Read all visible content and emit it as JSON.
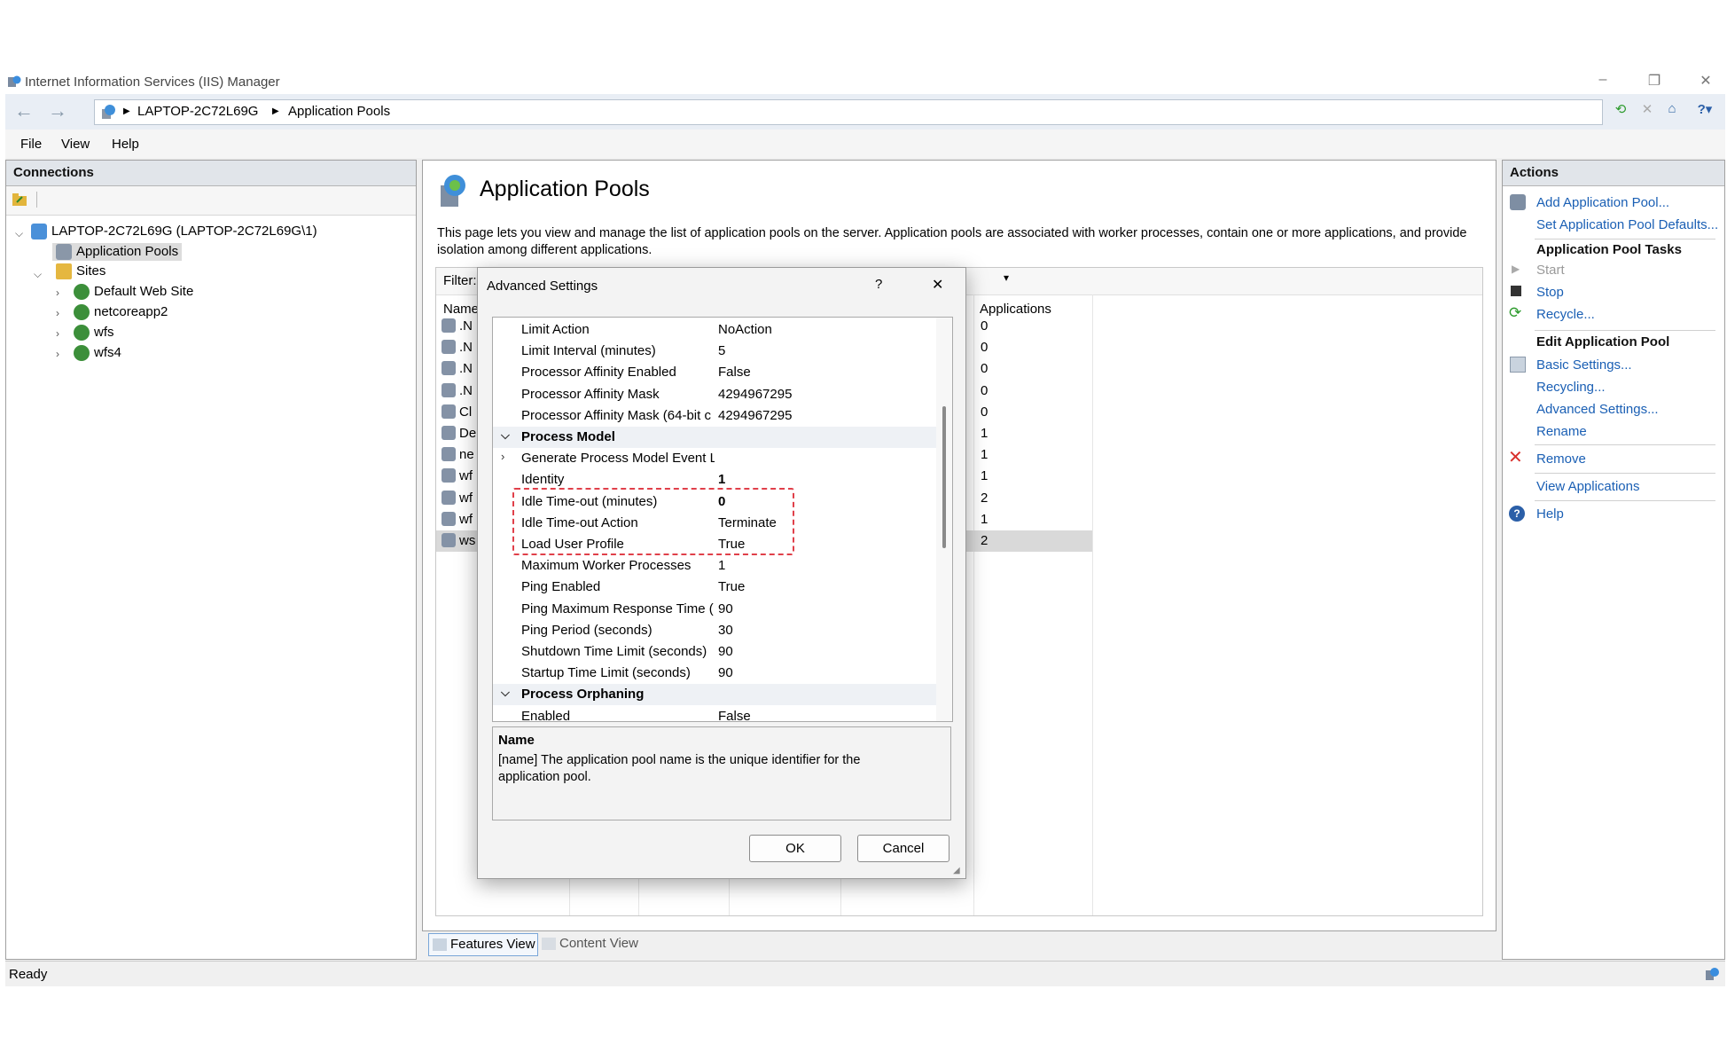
{
  "window": {
    "title": "Internet Information Services (IIS) Manager",
    "controls": [
      "–",
      "❐",
      "✕"
    ]
  },
  "address": {
    "breadcrumb": [
      "LAPTOP-2C72L69G",
      "Application Pools"
    ]
  },
  "menu": [
    "File",
    "View",
    "Help"
  ],
  "connections": {
    "title": "Connections",
    "server": "LAPTOP-2C72L69G (LAPTOP-2C72L69G\\1)",
    "app_pools": "Application Pools",
    "sites": "Sites",
    "site_list": [
      "Default Web Site",
      "netcoreapp2",
      "wfs",
      "wfs4"
    ]
  },
  "main": {
    "title": "Application Pools",
    "description": "This page lets you view and manage the list of application pools on the server. Application pools are associated with worker processes, contain one or more applications, and provide isolation among different applications.",
    "filter_label": "Filter:",
    "col_name": "Name",
    "col_applications": "Applications",
    "rows": [
      {
        "name": ".N",
        "apps": "0"
      },
      {
        "name": ".N",
        "apps": "0"
      },
      {
        "name": ".N",
        "apps": "0"
      },
      {
        "name": ".N",
        "apps": "0"
      },
      {
        "name": "Cl",
        "apps": "0"
      },
      {
        "name": "De",
        "apps": "1"
      },
      {
        "name": "ne",
        "apps": "1"
      },
      {
        "name": "wf",
        "apps": "1"
      },
      {
        "name": "wf",
        "apps": "2"
      },
      {
        "name": "wf",
        "apps": "1"
      },
      {
        "name": "ws",
        "apps": "2"
      }
    ],
    "view_features": "Features View",
    "view_content": "Content View"
  },
  "actions": {
    "title": "Actions",
    "add_pool": "Add Application Pool...",
    "set_defaults": "Set Application Pool Defaults...",
    "tasks_head": "Application Pool Tasks",
    "start": "Start",
    "stop": "Stop",
    "recycle": "Recycle...",
    "edit_head": "Edit Application Pool",
    "basic": "Basic Settings...",
    "recycling": "Recycling...",
    "advanced": "Advanced Settings...",
    "rename": "Rename",
    "remove": "Remove",
    "view_apps": "View Applications",
    "help": "Help"
  },
  "dialog": {
    "title": "Advanced Settings",
    "help_glyph": "?",
    "close_glyph": "✕",
    "rows": [
      {
        "k": "Limit Action",
        "v": "NoAction"
      },
      {
        "k": "Limit Interval (minutes)",
        "v": "5"
      },
      {
        "k": "Processor Affinity Enabled",
        "v": "False"
      },
      {
        "k": "Processor Affinity Mask",
        "v": "4294967295"
      },
      {
        "k": "Processor Affinity Mask (64-bit c",
        "v": "4294967295"
      },
      {
        "k": "Process Model",
        "v": "",
        "cat": true
      },
      {
        "k": "Generate Process Model Event L",
        "v": "",
        "expand": true
      },
      {
        "k": "Identity",
        "v": "1",
        "bold": true
      },
      {
        "k": "Idle Time-out (minutes)",
        "v": "0",
        "bold": true
      },
      {
        "k": "Idle Time-out Action",
        "v": "Terminate"
      },
      {
        "k": "Load User Profile",
        "v": "True"
      },
      {
        "k": "Maximum Worker Processes",
        "v": "1"
      },
      {
        "k": "Ping Enabled",
        "v": "True"
      },
      {
        "k": "Ping Maximum Response Time (",
        "v": "90"
      },
      {
        "k": "Ping Period (seconds)",
        "v": "30"
      },
      {
        "k": "Shutdown Time Limit (seconds)",
        "v": "90"
      },
      {
        "k": "Startup Time Limit (seconds)",
        "v": "90"
      },
      {
        "k": "Process Orphaning",
        "v": "",
        "cat": true
      },
      {
        "k": "Enabled",
        "v": "False"
      }
    ],
    "desc_title": "Name",
    "desc_text": "[name] The application pool name is the unique identifier for the application pool.",
    "ok": "OK",
    "cancel": "Cancel"
  },
  "status": "Ready",
  "colors": {
    "link": "#1a5fb4",
    "highlight_box": "#e0404a"
  }
}
